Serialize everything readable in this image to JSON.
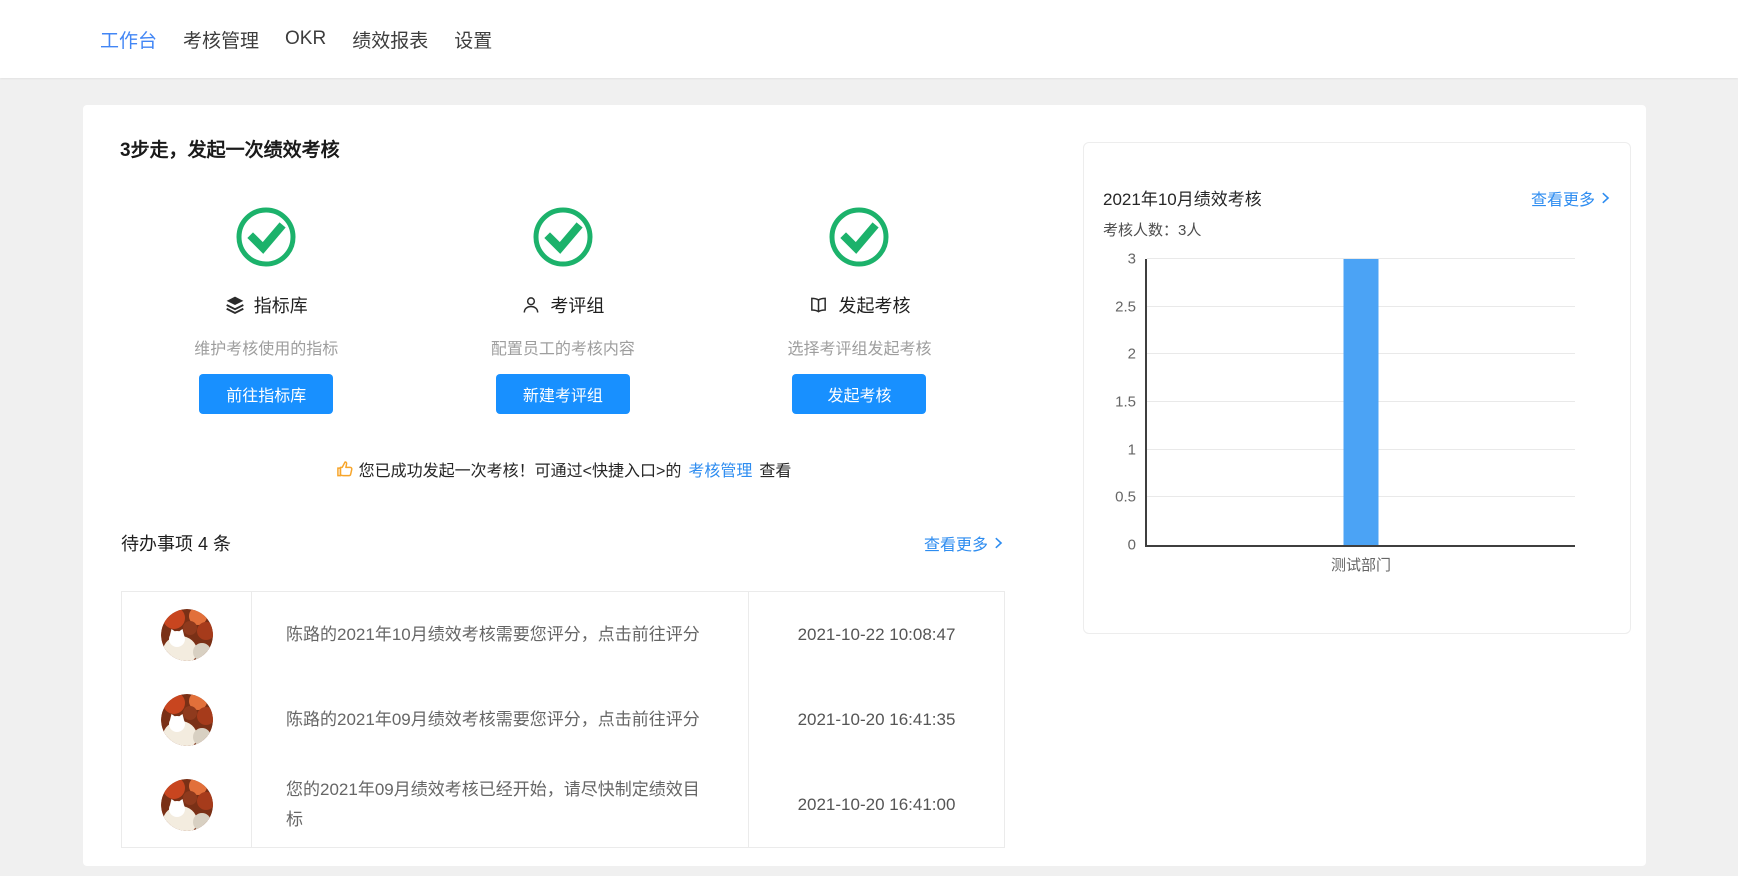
{
  "colors": {
    "accent_blue": "#1890ff",
    "link_blue": "#2d8cf0",
    "nav_active_blue": "#4286f5",
    "success_green": "#1cb26b",
    "bar_blue": "#4ba3f5",
    "thumb_orange": "#f7a52b"
  },
  "nav": {
    "items": [
      {
        "label": "工作台",
        "active": true
      },
      {
        "label": "考核管理",
        "active": false
      },
      {
        "label": "OKR",
        "active": false
      },
      {
        "label": "绩效报表",
        "active": false
      },
      {
        "label": "设置",
        "active": false
      }
    ]
  },
  "workflow": {
    "title": "3步走，发起一次绩效考核",
    "steps": [
      {
        "icon": "layers-icon",
        "name": "指标库",
        "desc": "维护考核使用的指标",
        "button": "前往指标库"
      },
      {
        "icon": "user-icon",
        "name": "考评组",
        "desc": "配置员工的考核内容",
        "button": "新建考评组"
      },
      {
        "icon": "book-icon",
        "name": "发起考核",
        "desc": "选择考评组发起考核",
        "button": "发起考核"
      }
    ],
    "success": {
      "prefix": "您已成功发起一次考核！可通过<快捷入口>的",
      "link": "考核管理",
      "suffix": "查看"
    }
  },
  "todo": {
    "title": "待办事项 4 条",
    "view_more": "查看更多",
    "items": [
      {
        "text": "陈路的2021年10月绩效考核需要您评分，点击前往评分",
        "time": "2021-10-22 10:08:47"
      },
      {
        "text": "陈路的2021年09月绩效考核需要您评分，点击前往评分",
        "time": "2021-10-20 16:41:35"
      },
      {
        "text": "您的2021年09月绩效考核已经开始，请尽快制定绩效目标",
        "time": "2021-10-20 16:41:00"
      }
    ]
  },
  "report": {
    "title": "2021年10月绩效考核",
    "view_more": "查看更多",
    "people_count": "考核人数：3人"
  },
  "chart_data": {
    "type": "bar",
    "title": "2021年10月绩效考核",
    "categories": [
      "测试部门"
    ],
    "values": [
      3
    ],
    "xlabel": "",
    "ylabel": "",
    "ylim": [
      0,
      3
    ],
    "yticks": [
      0,
      0.5,
      1,
      1.5,
      2,
      2.5,
      3
    ],
    "bar_color": "#4ba3f5",
    "grid": true,
    "legend": "none"
  }
}
